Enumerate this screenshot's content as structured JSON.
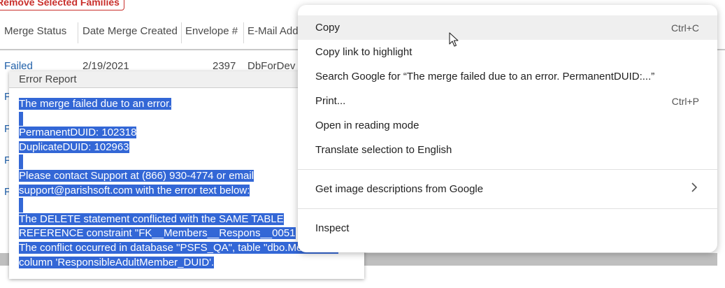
{
  "toolbar": {
    "remove_label": "Remove Selected Families"
  },
  "table": {
    "headers": [
      "Merge Status",
      "Date Merge Created",
      "Envelope #",
      "E-Mail Address"
    ],
    "row1": {
      "status": "Failed",
      "date": "2/19/2021",
      "envelope": "2397",
      "email": "DbForDev"
    },
    "row_stub": "F"
  },
  "popup": {
    "title": "Error Report",
    "lines": [
      "The merge failed due to an error.",
      "",
      "PermanentDUID: 102318",
      "DuplicateDUID: 102963",
      "",
      "Please contact Support at (866) 930-4774 or email",
      "support@parishsoft.com with the error text below:",
      "",
      "The DELETE statement conflicted with the SAME TABLE",
      "REFERENCE constraint \"FK__Members__Respons__0051",
      "The conflict occurred in database \"PSFS_QA\", table \"dbo.Members\",",
      "column 'ResponsibleAdultMember_DUID'."
    ]
  },
  "context_menu": {
    "items": [
      {
        "label": "Copy",
        "shortcut": "Ctrl+C"
      },
      {
        "label": "Copy link to highlight",
        "shortcut": ""
      },
      {
        "label": "Search Google for “The merge failed due to an error.  PermanentDUID:...”",
        "shortcut": ""
      },
      {
        "label": "Print...",
        "shortcut": "Ctrl+P"
      },
      {
        "label": "Open in reading mode",
        "shortcut": ""
      },
      {
        "label": "Translate selection to English",
        "shortcut": ""
      },
      {
        "label": "Get image descriptions from Google",
        "shortcut": ""
      },
      {
        "label": "Inspect",
        "shortcut": ""
      }
    ],
    "submenu_icon": "chevron-right-icon"
  },
  "colors": {
    "selection": "#3367d6",
    "link": "#1f5fa8",
    "danger": "#c9302c",
    "hover": "#efefef"
  }
}
